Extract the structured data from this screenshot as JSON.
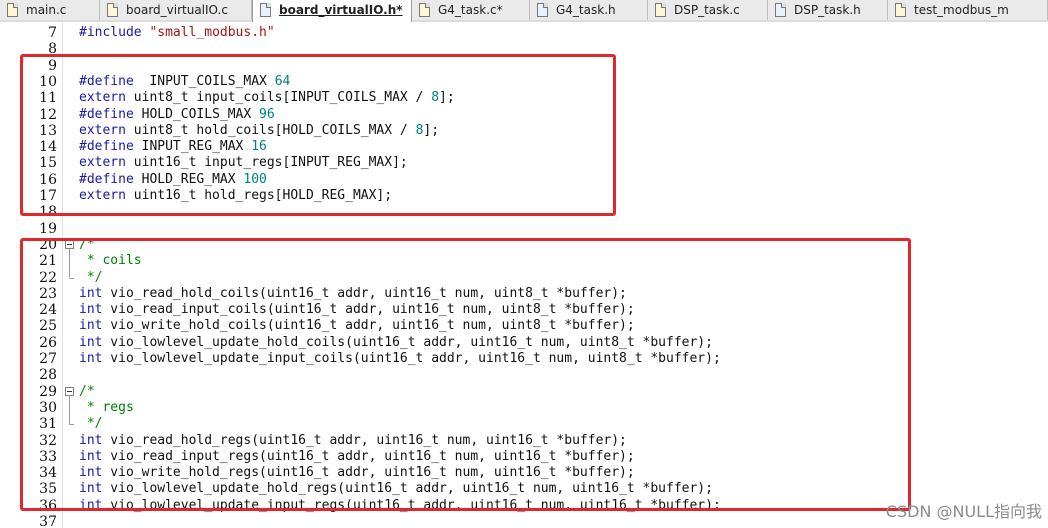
{
  "tabs": [
    {
      "label": "main.c",
      "type": "c",
      "active": false
    },
    {
      "label": "board_virtualIO.c",
      "type": "c",
      "active": false
    },
    {
      "label": "board_virtualIO.h*",
      "type": "h",
      "active": true
    },
    {
      "label": "G4_task.c*",
      "type": "c",
      "active": false
    },
    {
      "label": "G4_task.h",
      "type": "h",
      "active": false
    },
    {
      "label": "DSP_task.c",
      "type": "c",
      "active": false
    },
    {
      "label": "DSP_task.h",
      "type": "h",
      "active": false
    },
    {
      "label": "test_modbus_m",
      "type": "c",
      "active": false
    }
  ],
  "lines": [
    {
      "n": "7",
      "t": [
        [
          "pp",
          "#include "
        ],
        [
          "str",
          "\"small_modbus.h\""
        ]
      ]
    },
    {
      "n": "8",
      "t": []
    },
    {
      "n": "9",
      "t": []
    },
    {
      "n": "10",
      "t": [
        [
          "pp",
          "#define"
        ],
        [
          "",
          "  INPUT_COILS_MAX "
        ],
        [
          "num",
          "64"
        ]
      ]
    },
    {
      "n": "11",
      "t": [
        [
          "kw",
          "extern"
        ],
        [
          "",
          " uint8_t input_coils[INPUT_COILS_MAX / "
        ],
        [
          "num",
          "8"
        ],
        [
          "",
          "];"
        ]
      ]
    },
    {
      "n": "12",
      "t": [
        [
          "pp",
          "#define"
        ],
        [
          "",
          " HOLD_COILS_MAX "
        ],
        [
          "num",
          "96"
        ]
      ]
    },
    {
      "n": "13",
      "t": [
        [
          "kw",
          "extern"
        ],
        [
          "",
          " uint8_t hold_coils[HOLD_COILS_MAX / "
        ],
        [
          "num",
          "8"
        ],
        [
          "",
          "];"
        ]
      ]
    },
    {
      "n": "14",
      "t": [
        [
          "pp",
          "#define"
        ],
        [
          "",
          " INPUT_REG_MAX "
        ],
        [
          "num",
          "16"
        ]
      ]
    },
    {
      "n": "15",
      "t": [
        [
          "kw",
          "extern"
        ],
        [
          "",
          " uint16_t input_regs[INPUT_REG_MAX];"
        ]
      ]
    },
    {
      "n": "16",
      "t": [
        [
          "pp",
          "#define"
        ],
        [
          "",
          " HOLD_REG_MAX "
        ],
        [
          "num",
          "100"
        ]
      ]
    },
    {
      "n": "17",
      "t": [
        [
          "kw",
          "extern"
        ],
        [
          "",
          " uint16_t hold_regs[HOLD_REG_MAX];"
        ]
      ]
    },
    {
      "n": "18",
      "t": []
    },
    {
      "n": "19",
      "t": []
    },
    {
      "n": "20",
      "t": [
        [
          "cmt",
          "/*"
        ]
      ],
      "fold": "start"
    },
    {
      "n": "21",
      "t": [
        [
          "cmt",
          " * coils"
        ]
      ],
      "fold": "mid"
    },
    {
      "n": "22",
      "t": [
        [
          "cmt",
          " */"
        ]
      ],
      "fold": "end"
    },
    {
      "n": "23",
      "t": [
        [
          "kw",
          "int"
        ],
        [
          "",
          " vio_read_hold_coils(uint16_t addr, uint16_t num, uint8_t *buffer);"
        ]
      ]
    },
    {
      "n": "24",
      "t": [
        [
          "kw",
          "int"
        ],
        [
          "",
          " vio_read_input_coils(uint16_t addr, uint16_t num, uint8_t *buffer);"
        ]
      ]
    },
    {
      "n": "25",
      "t": [
        [
          "kw",
          "int"
        ],
        [
          "",
          " vio_write_hold_coils(uint16_t addr, uint16_t num, uint8_t *buffer);"
        ]
      ]
    },
    {
      "n": "26",
      "t": [
        [
          "kw",
          "int"
        ],
        [
          "",
          " vio_lowlevel_update_hold_coils(uint16_t addr, uint16_t num, uint8_t *buffer);"
        ]
      ]
    },
    {
      "n": "27",
      "t": [
        [
          "kw",
          "int"
        ],
        [
          "",
          " vio_lowlevel_update_input_coils(uint16_t addr, uint16_t num, uint8_t *buffer);"
        ]
      ]
    },
    {
      "n": "28",
      "t": []
    },
    {
      "n": "29",
      "t": [
        [
          "cmt",
          "/*"
        ]
      ],
      "fold": "start"
    },
    {
      "n": "30",
      "t": [
        [
          "cmt",
          " * regs"
        ]
      ],
      "fold": "mid"
    },
    {
      "n": "31",
      "t": [
        [
          "cmt",
          " */"
        ]
      ],
      "fold": "end"
    },
    {
      "n": "32",
      "t": [
        [
          "kw",
          "int"
        ],
        [
          "",
          " vio_read_hold_regs(uint16_t addr, uint16_t num, uint16_t *buffer);"
        ]
      ]
    },
    {
      "n": "33",
      "t": [
        [
          "kw",
          "int"
        ],
        [
          "",
          " vio_read_input_regs(uint16_t addr, uint16_t num, uint16_t *buffer);"
        ]
      ]
    },
    {
      "n": "34",
      "t": [
        [
          "kw",
          "int"
        ],
        [
          "",
          " vio_write_hold_regs(uint16_t addr, uint16_t num, uint16_t *buffer);"
        ]
      ]
    },
    {
      "n": "35",
      "t": [
        [
          "kw",
          "int"
        ],
        [
          "",
          " vio_lowlevel_update_hold_regs(uint16_t addr, uint16_t num, uint16_t *buffer);"
        ]
      ]
    },
    {
      "n": "36",
      "t": [
        [
          "kw",
          "int"
        ],
        [
          "",
          " vio_lowlevel_update_input_regs(uint16_t addr, uint16_t num, uint16_t *buffer);"
        ]
      ]
    },
    {
      "n": "37",
      "t": []
    }
  ],
  "annotations": {
    "highlight_color": "#e0272b"
  },
  "watermark": "CSDN @NULL指向我"
}
